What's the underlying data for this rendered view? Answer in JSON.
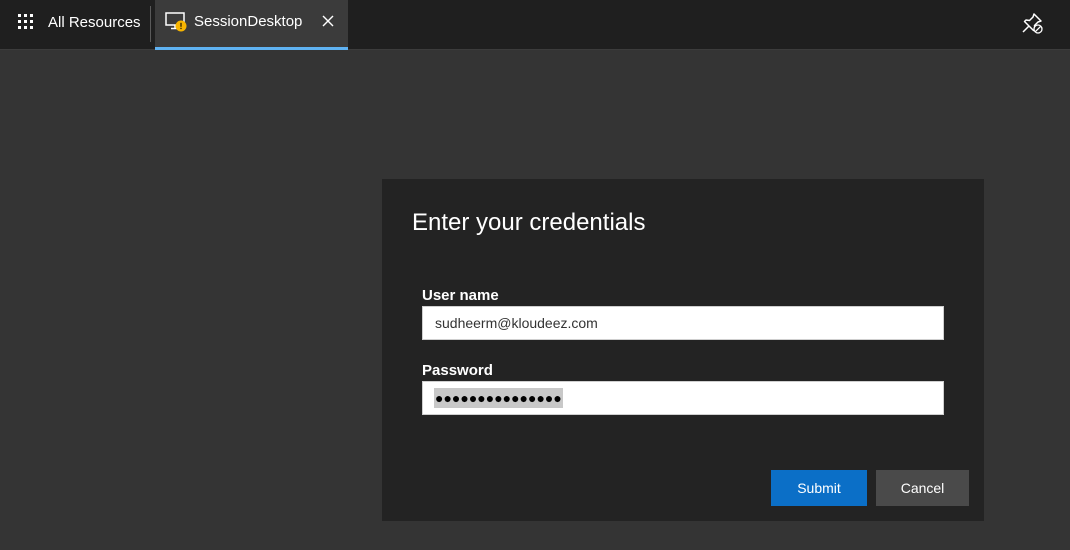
{
  "topbar": {
    "all_resources_label": "All Resources",
    "tab": {
      "label": "SessionDesktop",
      "badge_icon": "warning-badge-icon"
    },
    "icons": {
      "apps": "grid-icon",
      "monitor": "monitor-icon",
      "close": "close-icon",
      "pin": "unpin-icon"
    }
  },
  "dialog": {
    "title": "Enter your credentials",
    "username_label": "User name",
    "username_value": "sudheerm@kloudeez.com",
    "password_label": "Password",
    "password_masked": "●●●●●●●●●●●●●●●",
    "submit_label": "Submit",
    "cancel_label": "Cancel"
  },
  "colors": {
    "accent": "#0b6fc7",
    "tab_indicator": "#5fb2f2",
    "warning_badge": "#f8b500"
  }
}
